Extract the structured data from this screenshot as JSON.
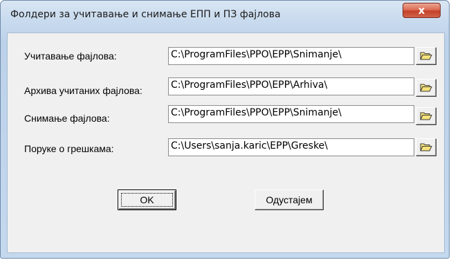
{
  "window": {
    "title": "Фолдери за учитавање и снимање ЕПП и ПЗ фајлова",
    "close_label": "x"
  },
  "rows": [
    {
      "label": "Учитавање фајлова:",
      "value": "C:\\ProgramFiles\\PPO\\EPP\\Snimanje\\"
    },
    {
      "label": "Архива учитаних фајлова:",
      "value": "C:\\ProgramFiles\\PPO\\EPP\\Arhiva\\"
    },
    {
      "label": "Снимање фајлова:",
      "value": "C:\\ProgramFiles\\PPO\\EPP\\Snimanje\\"
    },
    {
      "label": "Поруке о грешкама:",
      "value": "C:\\Users\\sanja.karic\\EPP\\Greske\\"
    }
  ],
  "buttons": {
    "ok_label": "OK",
    "cancel_label": "Одустајем"
  },
  "icons": {
    "browse": "folder-open-icon",
    "close": "close-icon"
  },
  "colors": {
    "folder_fill": "#f6e27a",
    "folder_stroke": "#3a3a3a",
    "close_red": "#c4402a"
  }
}
